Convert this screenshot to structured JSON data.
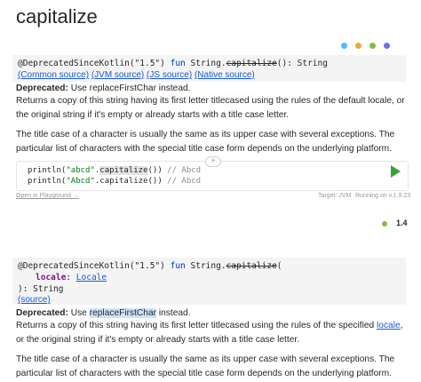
{
  "title": "capitalize",
  "platform_dot_colors": [
    "#4dbbff",
    "#e8a93b",
    "#7fbf3f",
    "#6e6ef4"
  ],
  "block1": {
    "annotation": "@DeprecatedSinceKotlin(\"1.5\")",
    "keyword_fun": "fun",
    "receiver": "String.",
    "name": "capitalize",
    "tail": "(): String",
    "sources": [
      "(Common source)",
      "(JVM source)",
      "(JS source)",
      "(Native source)"
    ],
    "deprecated_label": "Deprecated:",
    "deprecated_text": "Use replaceFirstChar instead.",
    "desc1": "Returns a copy of this string having its first letter titlecased using the rules of the default locale, or the original string if it's empty or already starts with a title case letter.",
    "desc2": "The title case of a character is usually the same as its upper case with several exceptions. The particular list of characters with the special title case form depends on the underlying platform."
  },
  "example": {
    "line1_pre": "println(",
    "line1_str": "\"abcd\"",
    "line1_dot": ".",
    "line1_fn": "capitalize",
    "line1_post": "()) ",
    "line1_comment": "// Abcd",
    "line2_pre": "println(",
    "line2_str": "\"Abcd\"",
    "line2_dot": ".",
    "line2_fn": "capitalize",
    "line2_post": "()) ",
    "line2_comment": "// Abcd",
    "open_link": "Open in Playground →",
    "target": "Target: JVM",
    "running": "Running on v.1.9.23"
  },
  "since_version": "1.4",
  "block2": {
    "annotation": "@DeprecatedSinceKotlin(\"1.5\")",
    "keyword_fun": "fun",
    "receiver": "String.",
    "name": "capitalize",
    "open_paren": "(",
    "param_name": "locale",
    "param_sep": ": ",
    "param_type": "Locale",
    "tail": "): String",
    "source": "(source)",
    "deprecated_label": "Deprecated:",
    "deprecated_use": "Use",
    "deprecated_fn": "replaceFirstChar",
    "deprecated_instead": "instead.",
    "desc1_pre": "Returns a copy of this string having its first letter titlecased using the rules of the specified",
    "desc1_link": "locale",
    "desc1_post": ", or the original string if it's empty or already starts with a title case letter.",
    "desc2": "The title case of a character is usually the same as its upper case with several exceptions. The particular list of characters with the special title case form depends on the underlying platform."
  }
}
